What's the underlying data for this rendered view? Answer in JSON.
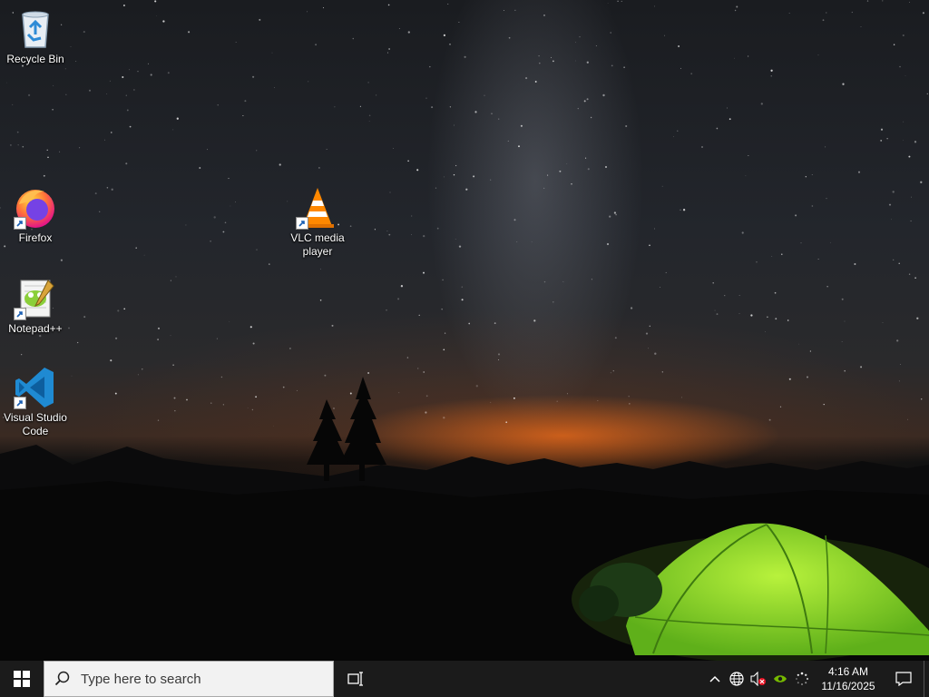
{
  "desktop": {
    "icons": [
      {
        "label": "Recycle Bin",
        "icon": "recycle-bin-icon"
      },
      {
        "label": "Firefox",
        "icon": "firefox-icon"
      },
      {
        "label": "Notepad++",
        "icon": "notepad-plus-plus-icon"
      },
      {
        "label": "Visual Studio Code",
        "icon": "vscode-icon"
      },
      {
        "label": "VLC media player",
        "icon": "vlc-icon"
      }
    ]
  },
  "taskbar": {
    "search_placeholder": "Type here to search",
    "clock_time": "4:16 AM",
    "clock_date": "11/16/2025"
  },
  "colors": {
    "taskbar_bg": "#1b1b1b",
    "tent_green": "#7fd82a",
    "horizon_orange": "#f06e19",
    "vscode_blue": "#1f8ad2"
  }
}
